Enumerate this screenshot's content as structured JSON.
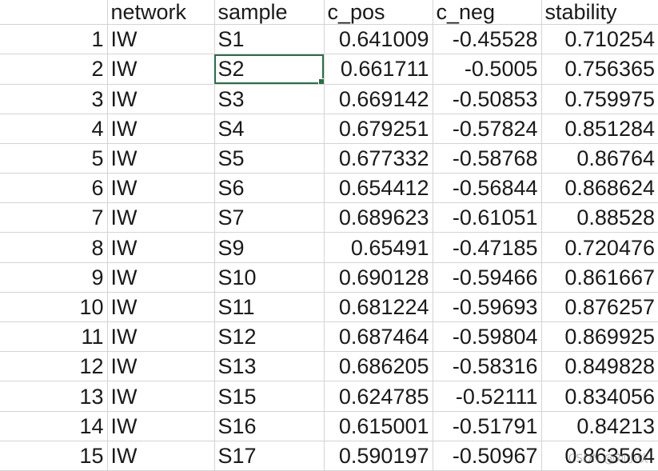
{
  "columns": {
    "index": "",
    "network": "network",
    "sample": "sample",
    "c_pos": "c_pos",
    "c_neg": "c_neg",
    "stability": "stability"
  },
  "rows": [
    {
      "index": "1",
      "network": "IW",
      "sample": "S1",
      "c_pos": "0.641009",
      "c_neg": "-0.45528",
      "stability": "0.710254"
    },
    {
      "index": "2",
      "network": "IW",
      "sample": "S2",
      "c_pos": "0.661711",
      "c_neg": "-0.5005",
      "stability": "0.756365"
    },
    {
      "index": "3",
      "network": "IW",
      "sample": "S3",
      "c_pos": "0.669142",
      "c_neg": "-0.50853",
      "stability": "0.759975"
    },
    {
      "index": "4",
      "network": "IW",
      "sample": "S4",
      "c_pos": "0.679251",
      "c_neg": "-0.57824",
      "stability": "0.851284"
    },
    {
      "index": "5",
      "network": "IW",
      "sample": "S5",
      "c_pos": "0.677332",
      "c_neg": "-0.58768",
      "stability": "0.86764"
    },
    {
      "index": "6",
      "network": "IW",
      "sample": "S6",
      "c_pos": "0.654412",
      "c_neg": "-0.56844",
      "stability": "0.868624"
    },
    {
      "index": "7",
      "network": "IW",
      "sample": "S7",
      "c_pos": "0.689623",
      "c_neg": "-0.61051",
      "stability": "0.88528"
    },
    {
      "index": "8",
      "network": "IW",
      "sample": "S9",
      "c_pos": "0.65491",
      "c_neg": "-0.47185",
      "stability": "0.720476"
    },
    {
      "index": "9",
      "network": "IW",
      "sample": "S10",
      "c_pos": "0.690128",
      "c_neg": "-0.59466",
      "stability": "0.861667"
    },
    {
      "index": "10",
      "network": "IW",
      "sample": "S11",
      "c_pos": "0.681224",
      "c_neg": "-0.59693",
      "stability": "0.876257"
    },
    {
      "index": "11",
      "network": "IW",
      "sample": "S12",
      "c_pos": "0.687464",
      "c_neg": "-0.59804",
      "stability": "0.869925"
    },
    {
      "index": "12",
      "network": "IW",
      "sample": "S13",
      "c_pos": "0.686205",
      "c_neg": "-0.58316",
      "stability": "0.849828"
    },
    {
      "index": "13",
      "network": "IW",
      "sample": "S15",
      "c_pos": "0.624785",
      "c_neg": "-0.52111",
      "stability": "0.834056"
    },
    {
      "index": "14",
      "network": "IW",
      "sample": "S16",
      "c_pos": "0.615001",
      "c_neg": "-0.51791",
      "stability": "0.84213"
    },
    {
      "index": "15",
      "network": "IW",
      "sample": "S17",
      "c_pos": "0.590197",
      "c_neg": "-0.50967",
      "stability": "0.863564"
    }
  ],
  "selection": {
    "row": 2,
    "column": "sample"
  },
  "colors": {
    "selection_border": "#217346",
    "gridline": "#d4d4d4"
  },
  "watermark": "CSDN @刘小伙"
}
